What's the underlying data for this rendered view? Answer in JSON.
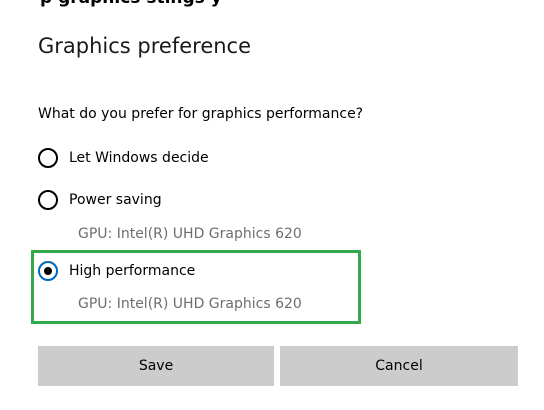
{
  "header_fragment": "p     graphics            stings y",
  "dialog": {
    "title": "Graphics preference",
    "question": "What do you prefer for graphics performance?",
    "options": [
      {
        "label": "Let Windows decide",
        "gpu": "",
        "selected": false
      },
      {
        "label": "Power saving",
        "gpu": "GPU: Intel(R) UHD Graphics 620",
        "selected": false
      },
      {
        "label": "High performance",
        "gpu": "GPU: Intel(R) UHD Graphics 620",
        "selected": true
      }
    ],
    "highlight_color": "#33a84a",
    "save_label": "Save",
    "cancel_label": "Cancel"
  }
}
